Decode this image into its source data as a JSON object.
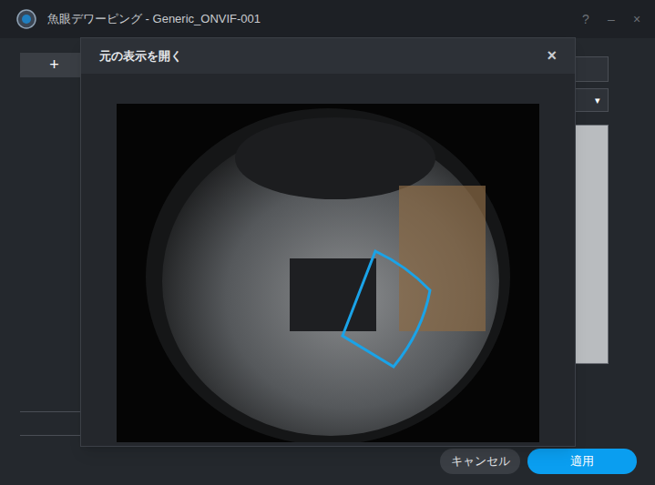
{
  "window": {
    "title": "魚眼デワーピング - Generic_ONVIF-001",
    "controls": [
      "?",
      "–",
      "×"
    ]
  },
  "toolbar": {
    "add_button": "+",
    "dropdown_arrow": "▾"
  },
  "dialog": {
    "title": "元の表示を開く",
    "close": "×",
    "view": {
      "kind": "fisheye-image",
      "region_highlighted": true
    }
  },
  "buttons": [
    {
      "label": "キャンセル",
      "primary": false
    },
    {
      "label": "適用",
      "primary": true
    }
  ]
}
